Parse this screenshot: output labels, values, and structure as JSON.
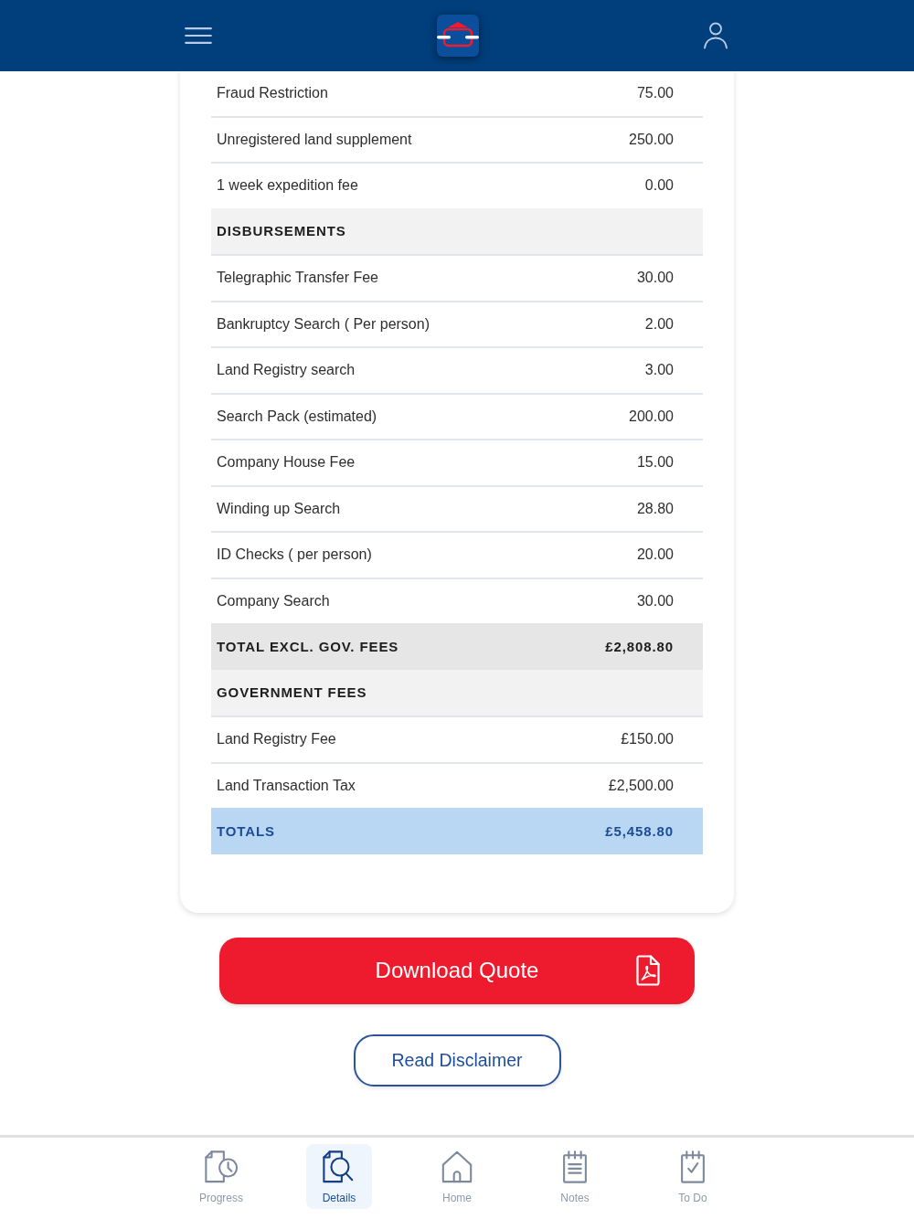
{
  "quote_table": {
    "rows": [
      {
        "kind": "item",
        "label": "Fraud Restriction",
        "amount": "75.00"
      },
      {
        "kind": "item",
        "label": "Unregistered land supplement",
        "amount": "250.00"
      },
      {
        "kind": "item",
        "label": "1 week expedition fee",
        "amount": "0.00"
      },
      {
        "kind": "section",
        "label": "DISBURSEMENTS"
      },
      {
        "kind": "item",
        "label": "Telegraphic Transfer Fee",
        "amount": "30.00"
      },
      {
        "kind": "item",
        "label": "Bankruptcy Search ( Per person)",
        "amount": "2.00"
      },
      {
        "kind": "item",
        "label": "Land Registry search",
        "amount": "3.00"
      },
      {
        "kind": "item",
        "label": "Search Pack (estimated)",
        "amount": "200.00"
      },
      {
        "kind": "item",
        "label": "Company House Fee",
        "amount": "15.00"
      },
      {
        "kind": "item",
        "label": "Winding up Search",
        "amount": "28.80"
      },
      {
        "kind": "item",
        "label": "ID Checks ( per person)",
        "amount": "20.00"
      },
      {
        "kind": "item",
        "label": "Company Search",
        "amount": "30.00"
      },
      {
        "kind": "subtotal",
        "label": "TOTAL EXCL. GOV. FEES",
        "amount": "£2,808.80"
      },
      {
        "kind": "section",
        "label": "GOVERNMENT FEES"
      },
      {
        "kind": "item",
        "label": "Land Registry Fee",
        "amount": "£150.00"
      },
      {
        "kind": "item",
        "label": "Land Transaction Tax",
        "amount": "£2,500.00"
      },
      {
        "kind": "total",
        "label": "TOTALS",
        "amount": "£5,458.80"
      }
    ]
  },
  "actions": {
    "download_button": "Download Quote",
    "disclaimer_button": "Read Disclaimer"
  },
  "bottom_nav": [
    {
      "label": "Progress",
      "selected": false
    },
    {
      "label": "Details",
      "selected": true
    },
    {
      "label": "Home",
      "selected": false
    },
    {
      "label": "Notes",
      "selected": false
    },
    {
      "label": "To Do",
      "selected": false
    }
  ]
}
